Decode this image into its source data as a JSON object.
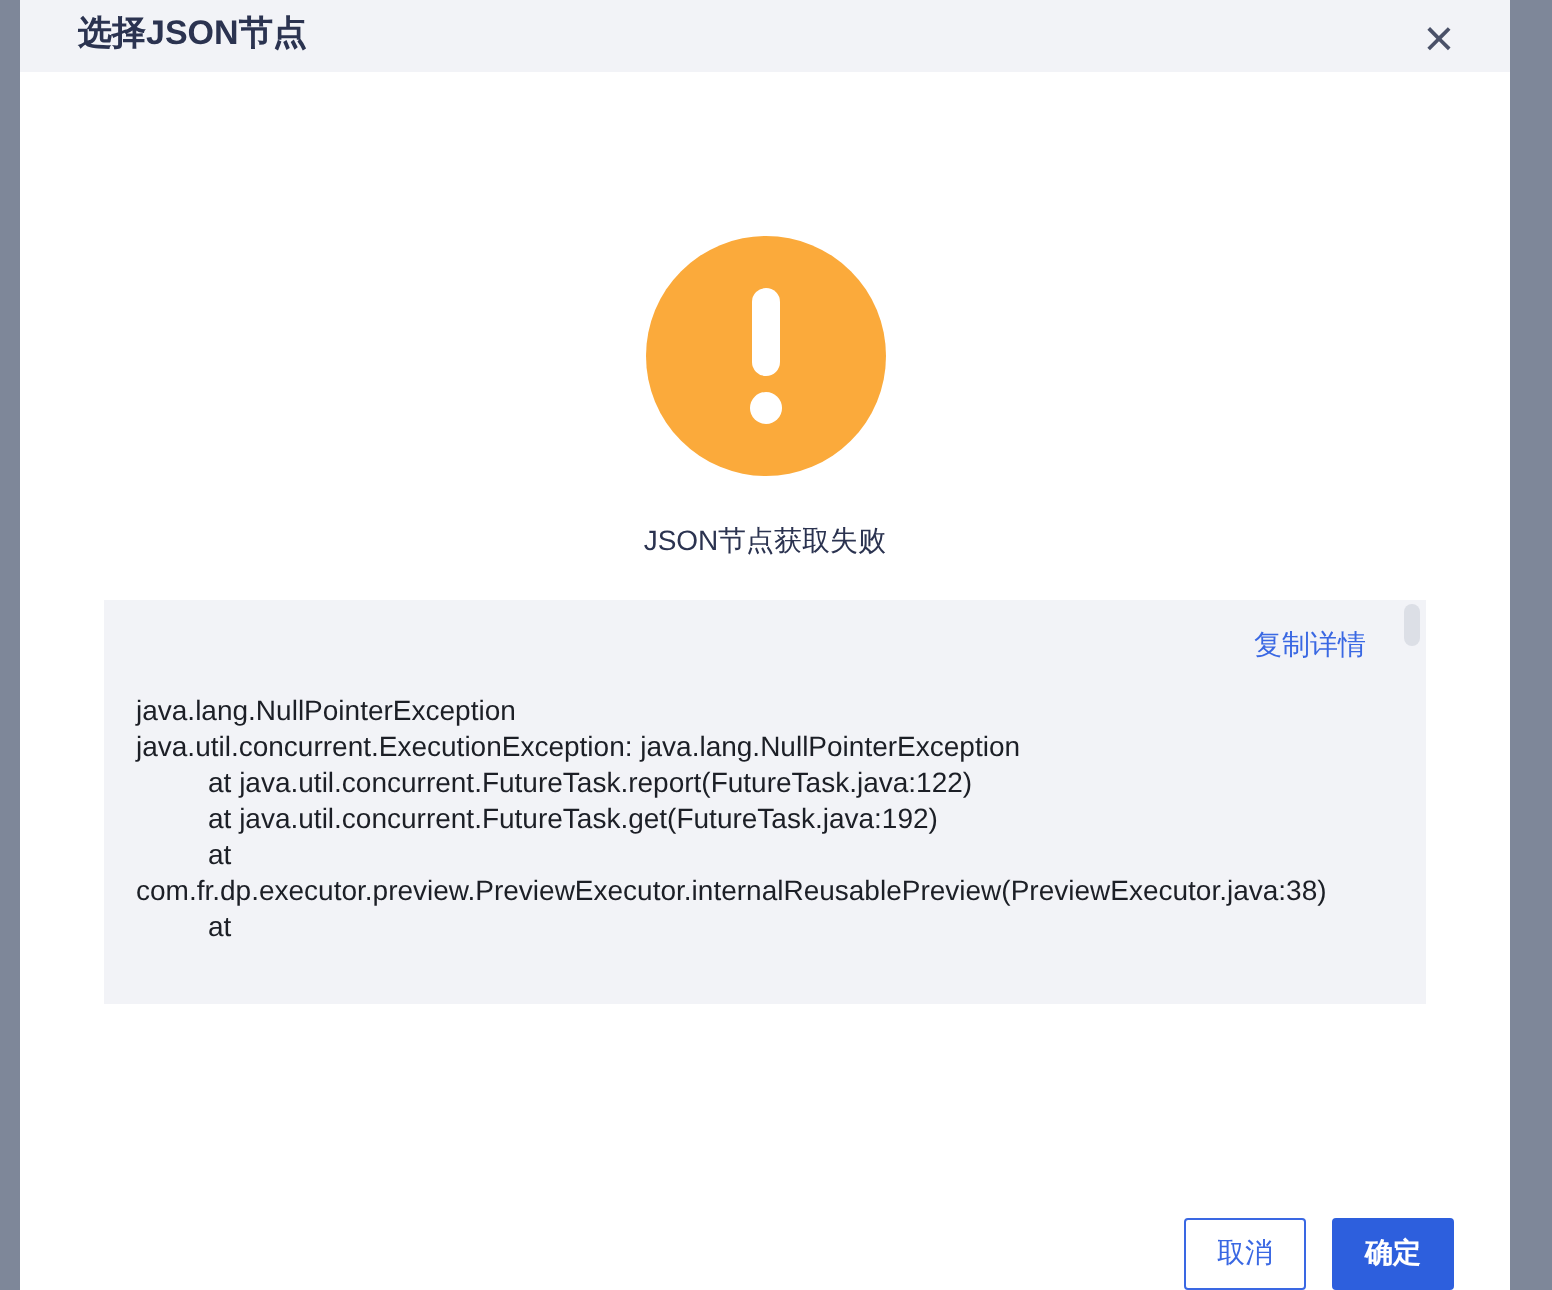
{
  "dialog": {
    "title": "选择JSON节点",
    "close": "×"
  },
  "message": "JSON节点获取失败",
  "details": {
    "copy_link": "复制详情",
    "lines": [
      {
        "text": "java.lang.NullPointerException",
        "kind": "plain"
      },
      {
        "text": "java.util.concurrent.ExecutionException: java.lang.NullPointerException",
        "kind": "plain"
      },
      {
        "text": "at java.util.concurrent.FutureTask.report(FutureTask.java:122)",
        "kind": "indented"
      },
      {
        "text": "at java.util.concurrent.FutureTask.get(FutureTask.java:192)",
        "kind": "indented"
      },
      {
        "text": "at",
        "kind": "indented"
      },
      {
        "text": "com.fr.dp.executor.preview.PreviewExecutor.internalReusablePreview(PreviewExecutor.java:38)",
        "kind": "plain"
      },
      {
        "text": "at",
        "kind": "indented"
      }
    ]
  },
  "buttons": [
    {
      "label": "取消",
      "kind": "secondary"
    },
    {
      "label": "确定",
      "kind": "primary"
    }
  ]
}
